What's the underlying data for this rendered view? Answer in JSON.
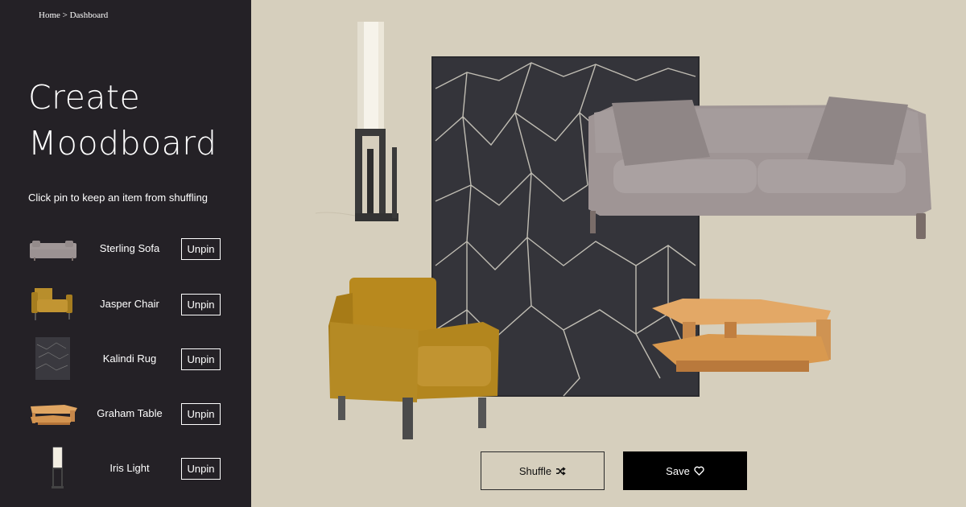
{
  "breadcrumb": {
    "home": "Home",
    "separator": ">",
    "current": "Dashboard"
  },
  "title": {
    "line1": "Create",
    "line2": "Moodboard"
  },
  "instructions": "Click pin to keep an item from shuffling",
  "pinned_items": [
    {
      "name": "Sterling Sofa",
      "action": "Unpin",
      "thumb": "sofa"
    },
    {
      "name": "Jasper Chair",
      "action": "Unpin",
      "thumb": "chair"
    },
    {
      "name": "Kalindi Rug",
      "action": "Unpin",
      "thumb": "rug"
    },
    {
      "name": "Graham Table",
      "action": "Unpin",
      "thumb": "table"
    },
    {
      "name": "Iris Light",
      "action": "Unpin",
      "thumb": "lamp"
    }
  ],
  "actions": {
    "shuffle": "Shuffle",
    "save": "Save"
  },
  "icons": {
    "shuffle": "shuffle-icon",
    "save": "heart-outline-icon"
  },
  "colors": {
    "sidebar": "#242126",
    "canvas": "#d6cfbd",
    "save_button": "#000000",
    "sofa": "#9e9596",
    "chair": "#b78a26",
    "rug": "#34343a",
    "table": "#d8a060"
  }
}
